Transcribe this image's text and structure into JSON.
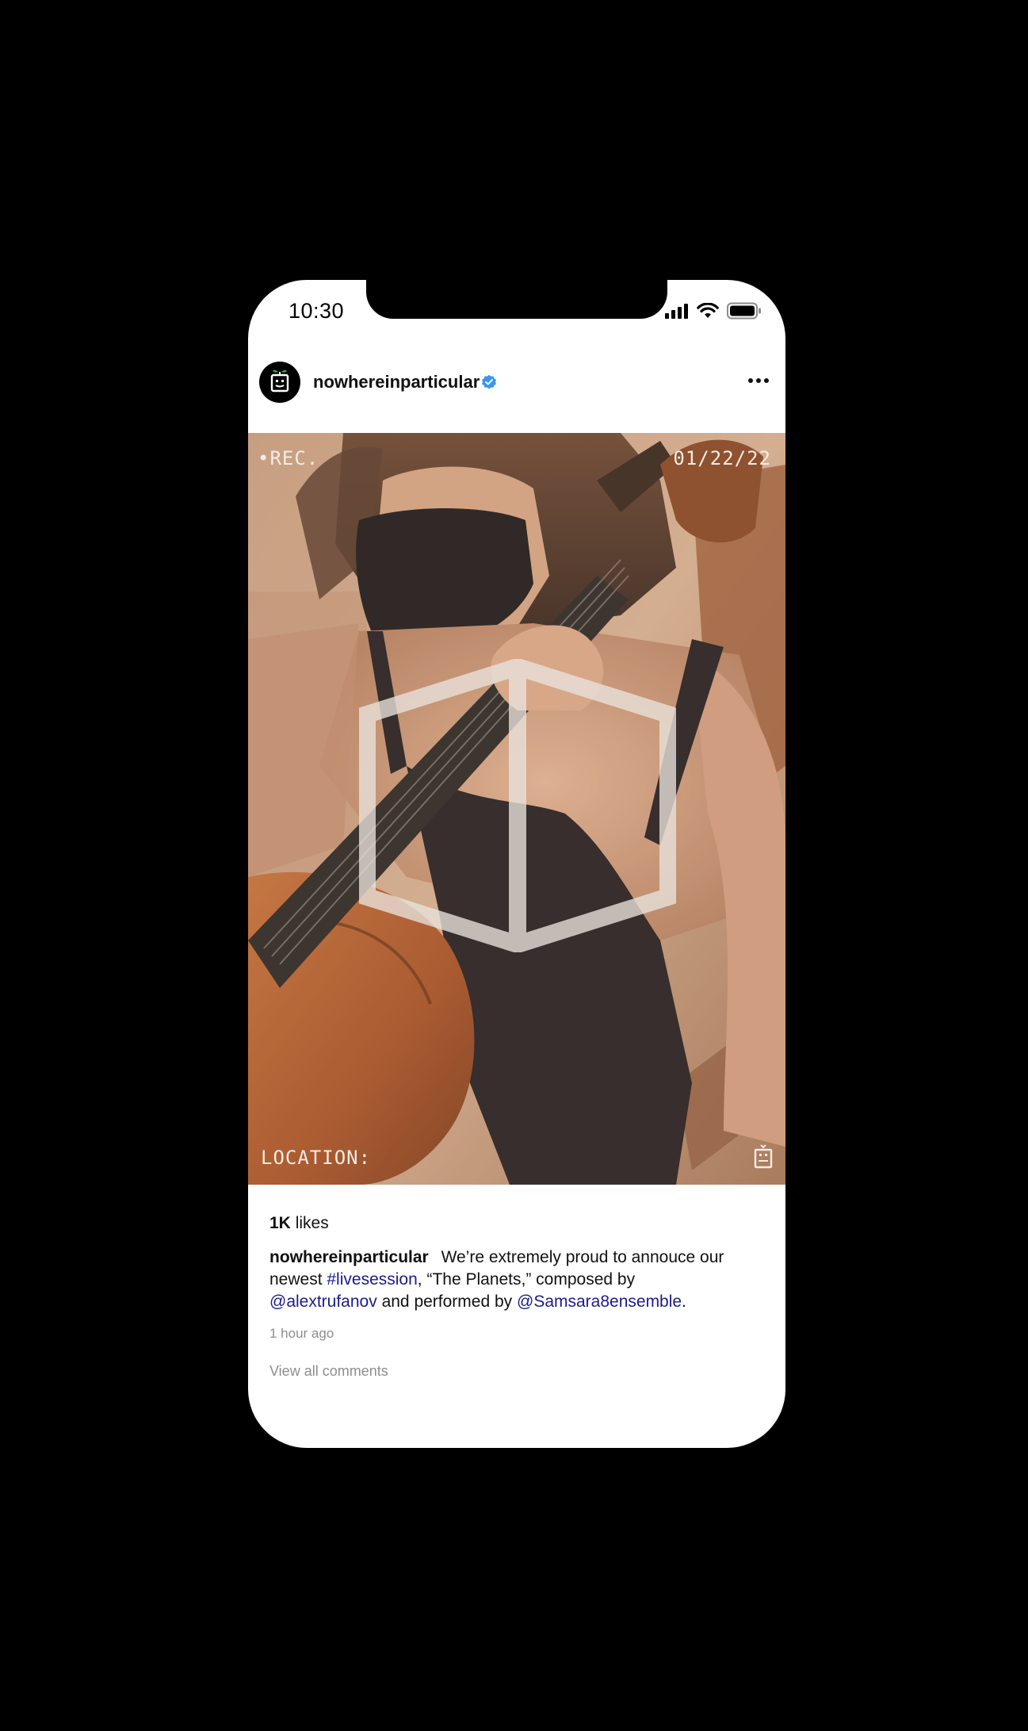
{
  "status_bar": {
    "time": "10:30",
    "icons": [
      "signal-icon",
      "wifi-icon",
      "battery-icon"
    ]
  },
  "post": {
    "username": "nowhereinparticular",
    "verified_icon": "verified-badge-icon",
    "more_icon": "more-options-icon",
    "media": {
      "rec_label": "•REC.",
      "date_label": "01/22/22",
      "location_label": "LOCATION:",
      "overlay_icon": "play-cube-icon"
    },
    "likes_count": "1K",
    "likes_label": "likes",
    "caption": {
      "user": "nowhereinparticular",
      "text_1": "We’re extremely proud to annouce our newest ",
      "hashtag": "#livesession",
      "text_2": ", “The Planets,” composed by ",
      "mention_1": "@alextrufanov",
      "text_3": " and performed by ",
      "mention_2": "@Samsara8ensemble",
      "text_4": "."
    },
    "timestamp": "1 hour ago",
    "view_comments": "View all comments"
  },
  "colors": {
    "link": "#1b1b8a",
    "verified": "#3897f0",
    "muted": "#8e8e8e"
  }
}
